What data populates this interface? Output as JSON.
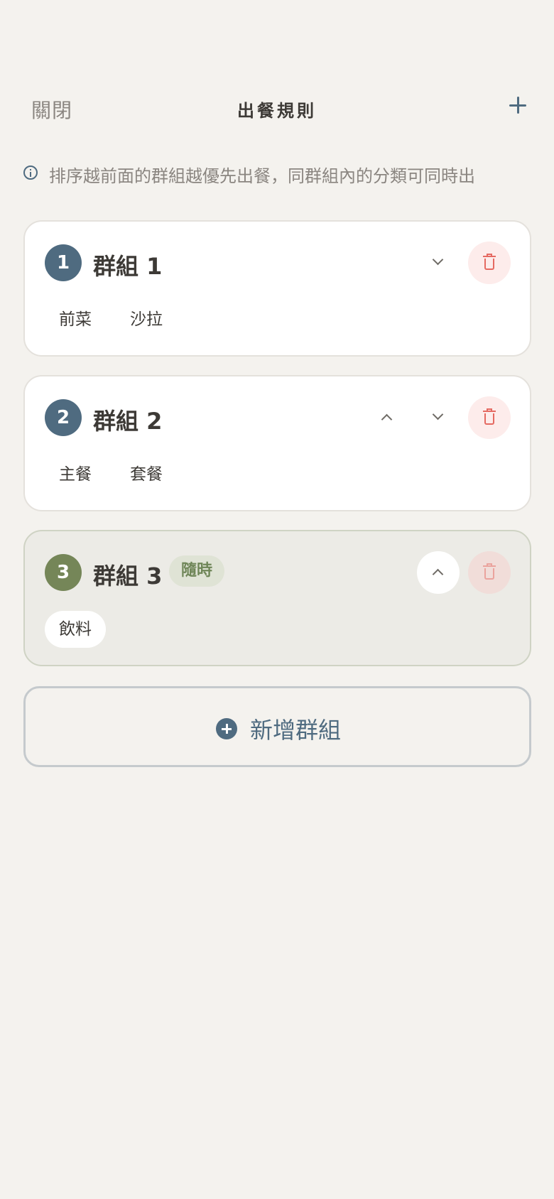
{
  "header": {
    "close_label": "關閉",
    "title": "出餐規則",
    "add_icon": "plus-icon"
  },
  "info": {
    "icon": "info-icon",
    "text": "排序越前面的群組越優先出餐，同群組內的分類可同時出"
  },
  "groups": [
    {
      "number": "1",
      "name": "群組 1",
      "tag": "",
      "categories": [
        "前菜",
        "沙拉"
      ],
      "controls": [
        "chevron-down"
      ],
      "active": false
    },
    {
      "number": "2",
      "name": "群組 2",
      "tag": "",
      "categories": [
        "主餐",
        "套餐"
      ],
      "controls": [
        "chevron-up",
        "chevron-down"
      ],
      "active": false
    },
    {
      "number": "3",
      "name": "群組 3",
      "tag": "隨時",
      "categories": [
        "飲料"
      ],
      "controls": [
        "chevron-up"
      ],
      "active": true
    }
  ],
  "new_group": {
    "label": "新增群組",
    "icon": "plus-circle-icon"
  },
  "colors": {
    "accent": "#4f6b80",
    "green_badge": "#758658",
    "danger": "#e56a62",
    "background": "#f4f2ee"
  }
}
